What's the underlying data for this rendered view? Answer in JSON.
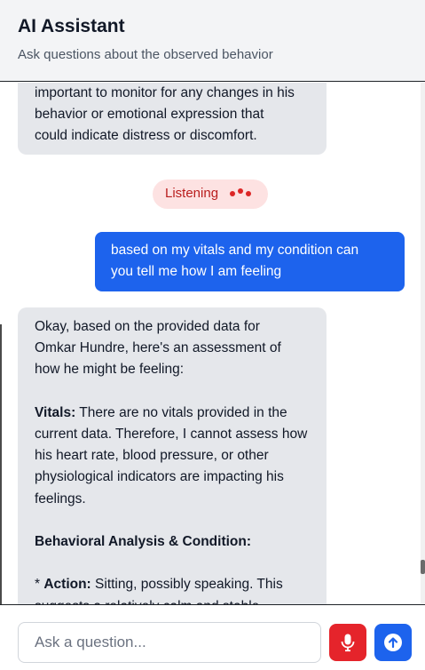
{
  "header": {
    "title": "AI Assistant",
    "subtitle": "Ask questions about the observed behavior"
  },
  "messages": {
    "ai_1": {
      "line_1": "important to monitor for any changes in his",
      "line_2": "behavior or emotional expression that",
      "line_3": "could indicate distress or discomfort."
    },
    "listening": {
      "label": "Listening"
    },
    "user_1": {
      "line_1": "based on my vitals and my condition can",
      "line_2": "you tell me how I am feeling"
    },
    "ai_2": {
      "intro_1": "Okay, based on the provided data for",
      "intro_2": "Omkar Hundre, here's an assessment of",
      "intro_3": "how he might be feeling:",
      "vitals_label": "Vitals:",
      "vitals_1": " There are no vitals provided in the",
      "vitals_2": "current data. Therefore, I cannot assess how",
      "vitals_3": "his heart rate, blood pressure, or other",
      "vitals_4": "physiological indicators are impacting his",
      "vitals_5": "feelings.",
      "behavioral_heading": "Behavioral Analysis & Condition:",
      "action_bullet": "* ",
      "action_label": "Action:",
      "action_1": " Sitting, possibly speaking. This",
      "action_2": "suggests a relatively calm and stable"
    }
  },
  "composer": {
    "placeholder": "Ask a question...",
    "mic_icon": "microphone-icon",
    "send_icon": "arrow-up-circle-icon"
  },
  "colors": {
    "user_bubble": "#1d63ed",
    "ai_bubble": "#e5e7eb",
    "mic_button": "#e5242b",
    "listening_bg": "#fde2e2",
    "listening_dots": "#dc2626"
  }
}
